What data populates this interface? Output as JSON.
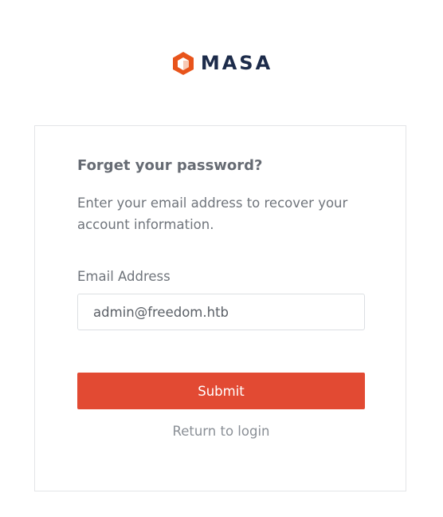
{
  "brand": {
    "name": "MASA",
    "logo_icon": "hexagon-cube-icon",
    "accent_color": "#e8541b",
    "text_color": "#1c2b4a"
  },
  "form": {
    "heading": "Forget your password?",
    "description": "Enter your email address to recover your account information.",
    "email_label": "Email Address",
    "email_value": "admin@freedom.htb",
    "submit_label": "Submit",
    "submit_color": "#e24a33",
    "return_label": "Return to login"
  }
}
